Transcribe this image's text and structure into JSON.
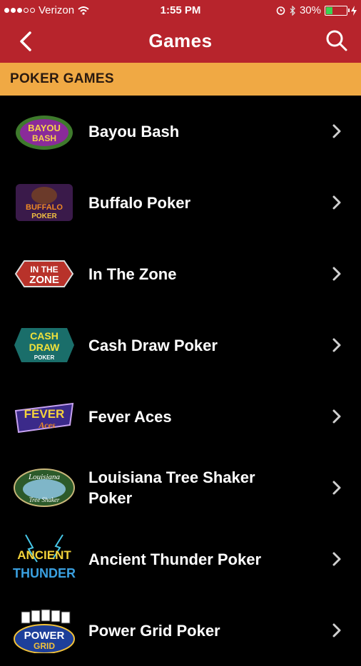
{
  "status_bar": {
    "carrier": "Verizon",
    "time": "1:55 PM",
    "battery": "30%"
  },
  "header": {
    "title": "Games"
  },
  "section": {
    "title": "POKER GAMES"
  },
  "games": [
    {
      "name": "Bayou Bash",
      "logo_text": [
        "BAYOU",
        "BASH"
      ]
    },
    {
      "name": "Buffalo Poker",
      "logo_text": [
        "BUFFALO",
        "POKER"
      ]
    },
    {
      "name": "In The Zone",
      "logo_text": [
        "IN THE",
        "ZONE"
      ]
    },
    {
      "name": "Cash Draw Poker",
      "logo_text": [
        "CASH",
        "DRAW",
        "POKER"
      ]
    },
    {
      "name": "Fever Aces",
      "logo_text": [
        "FEVER",
        "Aces"
      ]
    },
    {
      "name": "Louisiana Tree Shaker Poker",
      "logo_text": [
        "Louisiana",
        "Tree Shaker"
      ]
    },
    {
      "name": "Ancient Thunder Poker",
      "logo_text": [
        "ANCIENT",
        "THUNDER"
      ]
    },
    {
      "name": "Power Grid Poker",
      "logo_text": [
        "POWER",
        "GRID"
      ]
    }
  ],
  "colors": {
    "header": "#b7242c",
    "section": "#f0a944",
    "background": "#000000"
  }
}
